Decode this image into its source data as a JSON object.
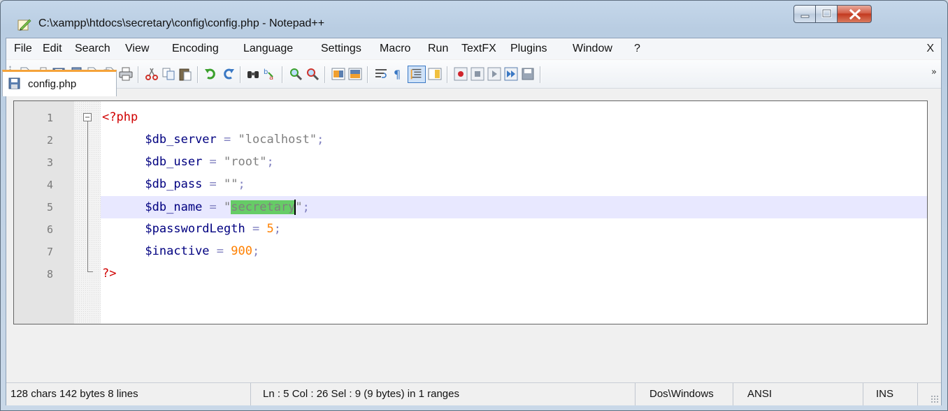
{
  "window": {
    "title": "C:\\xampp\\htdocs\\secretary\\config\\config.php - Notepad++",
    "close_color": "#c3391f"
  },
  "menu": {
    "items": [
      "File",
      "Edit",
      "Search",
      "View",
      "Encoding",
      "Language",
      "Settings",
      "Macro",
      "Run",
      "TextFX",
      "Plugins",
      "Window",
      "?"
    ],
    "close_label": "X"
  },
  "toolbar": {
    "icons": [
      "new-file-icon",
      "open-file-icon",
      "save-icon",
      "save-all-icon",
      "close-icon",
      "close-all-icon",
      "print-icon",
      "cut-icon",
      "copy-icon",
      "paste-icon",
      "undo-icon",
      "redo-icon",
      "find-icon",
      "replace-icon",
      "zoom-in-icon",
      "zoom-out-icon",
      "sync-vertical-icon",
      "sync-horizontal-icon",
      "word-wrap-icon",
      "show-all-chars-icon",
      "indent-guide-icon",
      "doc-map-icon",
      "macro-record-icon",
      "macro-stop-icon",
      "macro-play-icon",
      "macro-run-multiple-icon",
      "macro-save-icon"
    ],
    "overflow_label": "»"
  },
  "tabs": [
    {
      "label": "config.php",
      "active": true
    }
  ],
  "editor": {
    "lines": [
      {
        "num": "1"
      },
      {
        "num": "2"
      },
      {
        "num": "3"
      },
      {
        "num": "4"
      },
      {
        "num": "5"
      },
      {
        "num": "6"
      },
      {
        "num": "7"
      },
      {
        "num": "8"
      }
    ],
    "code": {
      "l1_tag": "<?php",
      "l2_var": "$db_server",
      "l2_op": " = ",
      "l2_str": "\"localhost\"",
      "l2_semi": ";",
      "l3_var": "$db_user",
      "l3_op": " = ",
      "l3_str": "\"root\"",
      "l3_semi": ";",
      "l4_var": "$db_pass",
      "l4_op": " = ",
      "l4_str": "\"\"",
      "l4_semi": ";",
      "l5_var": "$db_name",
      "l5_op": " = ",
      "l5_str_open": "\"",
      "l5_selected": "secretary",
      "l5_str_close": "\"",
      "l5_semi": ";",
      "l6_var": "$passwordLegth",
      "l6_op": " = ",
      "l6_num": "5",
      "l6_semi": ";",
      "l7_var": "$inactive",
      "l7_op": " = ",
      "l7_num": "900",
      "l7_semi": ";",
      "l8_tag": "?>"
    },
    "current_line": 5,
    "selection_color": "#66cc66"
  },
  "status": {
    "length": "128 chars  142 bytes  8 lines",
    "position": "Ln : 5    Col : 26    Sel : 9 (9 bytes) in 1 ranges",
    "eol": "Dos\\Windows",
    "encoding": "ANSI",
    "mode": "INS"
  }
}
